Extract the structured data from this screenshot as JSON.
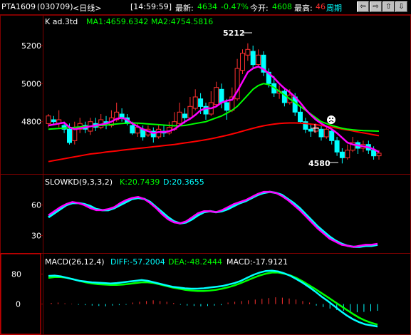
{
  "header": {
    "symbol": "PTA1609",
    "code": "(030709)",
    "period": "<日线>",
    "time": "[14:59:59]",
    "latest_label": "最新:",
    "latest_value": "4634",
    "change_pct": "-0.47%",
    "open_label": "今开:",
    "open_value": "4608",
    "high_label": "最高:",
    "high_value": "46",
    "cycle_link": "周期"
  },
  "nav_buttons": [
    {
      "name": "prev-button",
      "icon": "left-arrow-icon",
      "glyph": "⇦"
    },
    {
      "name": "next-button",
      "icon": "right-arrow-icon",
      "glyph": "⇨"
    },
    {
      "name": "zoom-in-button",
      "icon": "up-arrow-icon",
      "glyph": "⇧"
    },
    {
      "name": "zoom-out-button",
      "icon": "down-arrow-icon",
      "glyph": "⇩"
    }
  ],
  "colors": {
    "up": "#ff3030",
    "down": "#00ffff",
    "ma1": "#ff00ff",
    "ma2": "#00ff00",
    "ma3": "#ff0000",
    "k": "#ff00ff",
    "d": "#00ffff",
    "diff": "#00ffff",
    "dea": "#00ff00",
    "grid": "#800000"
  },
  "chart_data": [
    {
      "type": "candlestick",
      "title": "K ad.3td",
      "legend": [
        {
          "name": "MA1",
          "value": "4659.6342",
          "color": "#00ff00"
        },
        {
          "name": "MA2",
          "value": "4754.5816",
          "color": "#00ff00"
        }
      ],
      "y_ticks": [
        5200,
        5000,
        4800
      ],
      "ylim": [
        4540,
        5290
      ],
      "annotations": {
        "high": "5212",
        "low": "4580"
      },
      "candles": [
        [
          4790,
          4830,
          4770,
          4840
        ],
        [
          4810,
          4800,
          4780,
          4830
        ],
        [
          4790,
          4810,
          4770,
          4860
        ],
        [
          4780,
          4760,
          4740,
          4800
        ],
        [
          4760,
          4690,
          4680,
          4790
        ],
        [
          4700,
          4770,
          4680,
          4800
        ],
        [
          4760,
          4790,
          4740,
          4820
        ],
        [
          4780,
          4760,
          4740,
          4800
        ],
        [
          4750,
          4800,
          4730,
          4820
        ],
        [
          4790,
          4770,
          4750,
          4820
        ],
        [
          4770,
          4810,
          4760,
          4840
        ],
        [
          4800,
          4790,
          4760,
          4830
        ],
        [
          4780,
          4820,
          4770,
          4860
        ],
        [
          4810,
          4850,
          4800,
          4900
        ],
        [
          4840,
          4820,
          4800,
          4870
        ],
        [
          4820,
          4790,
          4780,
          4840
        ],
        [
          4780,
          4740,
          4730,
          4800
        ],
        [
          4740,
          4770,
          4720,
          4790
        ],
        [
          4760,
          4720,
          4700,
          4780
        ],
        [
          4730,
          4760,
          4720,
          4780
        ],
        [
          4750,
          4720,
          4690,
          4770
        ],
        [
          4720,
          4760,
          4710,
          4780
        ],
        [
          4750,
          4740,
          4720,
          4780
        ],
        [
          4740,
          4770,
          4730,
          4800
        ],
        [
          4760,
          4800,
          4750,
          4850
        ],
        [
          4790,
          4850,
          4780,
          4900
        ],
        [
          4840,
          4820,
          4790,
          4870
        ],
        [
          4820,
          4880,
          4810,
          4930
        ],
        [
          4870,
          4930,
          4860,
          4970
        ],
        [
          4920,
          4880,
          4840,
          4950
        ],
        [
          4880,
          4840,
          4810,
          4900
        ],
        [
          4840,
          4900,
          4830,
          4960
        ],
        [
          4890,
          4980,
          4880,
          5010
        ],
        [
          4970,
          4900,
          4870,
          5000
        ],
        [
          4900,
          4860,
          4810,
          4920
        ],
        [
          4860,
          4930,
          4850,
          4980
        ],
        [
          4920,
          5080,
          4910,
          5130
        ],
        [
          5070,
          5160,
          5050,
          5180
        ],
        [
          5150,
          5180,
          5120,
          5212
        ],
        [
          5170,
          5100,
          5080,
          5200
        ],
        [
          5100,
          5150,
          5090,
          5180
        ],
        [
          5150,
          5060,
          5040,
          5170
        ],
        [
          5060,
          5000,
          4980,
          5080
        ],
        [
          5000,
          4950,
          4930,
          5040
        ],
        [
          4950,
          4960,
          4920,
          4990
        ],
        [
          4960,
          4900,
          4880,
          4980
        ],
        [
          4900,
          4940,
          4890,
          4970
        ],
        [
          4930,
          4850,
          4830,
          4950
        ],
        [
          4850,
          4800,
          4790,
          4880
        ],
        [
          4800,
          4760,
          4740,
          4820
        ],
        [
          4760,
          4750,
          4720,
          4790
        ],
        [
          4750,
          4770,
          4740,
          4790
        ],
        [
          4760,
          4720,
          4700,
          4780
        ],
        [
          4720,
          4760,
          4710,
          4780
        ],
        [
          4750,
          4700,
          4680,
          4760
        ],
        [
          4700,
          4640,
          4620,
          4720
        ],
        [
          4640,
          4610,
          4580,
          4660
        ],
        [
          4610,
          4650,
          4600,
          4680
        ],
        [
          4650,
          4690,
          4640,
          4720
        ],
        [
          4690,
          4660,
          4630,
          4700
        ],
        [
          4660,
          4680,
          4640,
          4700
        ],
        [
          4680,
          4650,
          4630,
          4700
        ],
        [
          4650,
          4620,
          4600,
          4670
        ],
        [
          4620,
          4634,
          4600,
          4650
        ]
      ],
      "ma1": [
        4780,
        4785,
        4790,
        4795,
        4770,
        4760,
        4765,
        4770,
        4775,
        4780,
        4785,
        4790,
        4800,
        4815,
        4820,
        4810,
        4790,
        4775,
        4760,
        4750,
        4740,
        4745,
        4745,
        4750,
        4760,
        4780,
        4800,
        4815,
        4835,
        4860,
        4870,
        4870,
        4880,
        4900,
        4910,
        4915,
        4960,
        5010,
        5060,
        5080,
        5090,
        5075,
        5055,
        5030,
        5000,
        4975,
        4955,
        4930,
        4900,
        4865,
        4835,
        4810,
        4790,
        4775,
        4760,
        4740,
        4715,
        4690,
        4680,
        4675,
        4670,
        4665,
        4655,
        4640
      ],
      "ma2": [
        4760,
        4762,
        4764,
        4766,
        4768,
        4770,
        4772,
        4774,
        4776,
        4778,
        4780,
        4782,
        4785,
        4788,
        4790,
        4792,
        4793,
        4792,
        4790,
        4788,
        4786,
        4784,
        4782,
        4780,
        4778,
        4778,
        4780,
        4785,
        4790,
        4795,
        4800,
        4810,
        4820,
        4830,
        4845,
        4860,
        4880,
        4910,
        4940,
        4970,
        4990,
        5000,
        4995,
        4980,
        4960,
        4940,
        4920,
        4900,
        4880,
        4860,
        4840,
        4820,
        4800,
        4790,
        4780,
        4772,
        4765,
        4760,
        4757,
        4755,
        4753,
        4752,
        4751,
        4750
      ],
      "ma3": [
        4590,
        4595,
        4600,
        4605,
        4610,
        4615,
        4620,
        4625,
        4630,
        4633,
        4636,
        4640,
        4643,
        4646,
        4650,
        4653,
        4656,
        4659,
        4662,
        4665,
        4668,
        4671,
        4674,
        4677,
        4680,
        4684,
        4688,
        4692,
        4696,
        4700,
        4705,
        4710,
        4716,
        4722,
        4728,
        4735,
        4742,
        4750,
        4758,
        4765,
        4772,
        4778,
        4783,
        4787,
        4790,
        4792,
        4793,
        4793,
        4792,
        4790,
        4787,
        4784,
        4780,
        4776,
        4771,
        4766,
        4761,
        4756,
        4751,
        4746,
        4741,
        4736,
        4731,
        4726
      ]
    },
    {
      "type": "line",
      "title": "SLOWKD(9,3,3,2)",
      "legend": [
        {
          "name": "K",
          "value": "20.7439",
          "color": "#00ff00"
        },
        {
          "name": "D",
          "value": "20.3655",
          "color": "#00ffff"
        }
      ],
      "y_ticks": [
        60,
        30
      ],
      "ylim": [
        15,
        78
      ],
      "series": [
        {
          "name": "K",
          "values": [
            50,
            54,
            58,
            61,
            63,
            62,
            60,
            57,
            55,
            55,
            56,
            58,
            62,
            65,
            67,
            68,
            66,
            62,
            57,
            51,
            46,
            43,
            42,
            44,
            48,
            52,
            54,
            54,
            53,
            55,
            58,
            61,
            63,
            65,
            68,
            71,
            73,
            73,
            72,
            69,
            65,
            60,
            55,
            49,
            43,
            37,
            32,
            27,
            24,
            21,
            20,
            19,
            20,
            21,
            21,
            22
          ]
        },
        {
          "name": "D",
          "values": [
            48,
            52,
            56,
            60,
            62,
            62,
            61,
            59,
            56,
            55,
            55,
            57,
            60,
            63,
            66,
            67,
            66,
            63,
            58,
            53,
            48,
            44,
            42,
            43,
            46,
            50,
            53,
            54,
            53,
            54,
            56,
            59,
            62,
            64,
            67,
            70,
            72,
            73,
            72,
            70,
            66,
            62,
            57,
            51,
            45,
            39,
            34,
            29,
            25,
            22,
            20,
            19,
            19,
            20,
            20,
            21
          ]
        }
      ]
    },
    {
      "type": "line",
      "title": "MACD(26,12,4)",
      "legend": [
        {
          "name": "DIFF",
          "value": "-57.2004",
          "color": "#00ffff"
        },
        {
          "name": "DEA",
          "value": "-48.2444",
          "color": "#00ff00"
        },
        {
          "name": "MACD",
          "value": "-17.9121",
          "color": "#ffffff"
        }
      ],
      "y_ticks": [
        80,
        0
      ],
      "ylim": [
        -75,
        100
      ],
      "series": [
        {
          "name": "DIFF",
          "values": [
            75,
            76,
            74,
            70,
            66,
            62,
            60,
            58,
            57,
            56,
            55,
            56,
            58,
            60,
            62,
            64,
            62,
            58,
            54,
            50,
            46,
            44,
            42,
            41,
            41,
            42,
            44,
            46,
            48,
            52,
            56,
            62,
            70,
            78,
            84,
            88,
            89,
            87,
            82,
            75,
            66,
            56,
            45,
            33,
            20,
            8,
            -5,
            -18,
            -30,
            -40,
            -48,
            -54,
            -57,
            -60
          ]
        },
        {
          "name": "DEA",
          "values": [
            70,
            72,
            72,
            70,
            66,
            62,
            58,
            55,
            53,
            52,
            51,
            51,
            52,
            54,
            56,
            58,
            58,
            56,
            52,
            48,
            44,
            41,
            38,
            36,
            35,
            35,
            36,
            38,
            41,
            45,
            50,
            56,
            63,
            70,
            76,
            81,
            84,
            84,
            81,
            76,
            69,
            60,
            50,
            40,
            29,
            18,
            7,
            -4,
            -15,
            -26,
            -36,
            -44,
            -50,
            -55
          ]
        }
      ],
      "histogram": [
        3,
        4,
        2,
        1,
        -2,
        -3,
        -4,
        -5,
        -6,
        -4,
        -3,
        -2,
        4,
        6,
        8,
        10,
        8,
        6,
        3,
        -2,
        -4,
        -5,
        -6,
        -5,
        -4,
        -3,
        4,
        6,
        8,
        10,
        12,
        14,
        16,
        18,
        17,
        15,
        12,
        8,
        4,
        -4,
        -8,
        -12,
        -16,
        -18,
        -20,
        -22,
        -21,
        -19,
        -18
      ]
    }
  ]
}
